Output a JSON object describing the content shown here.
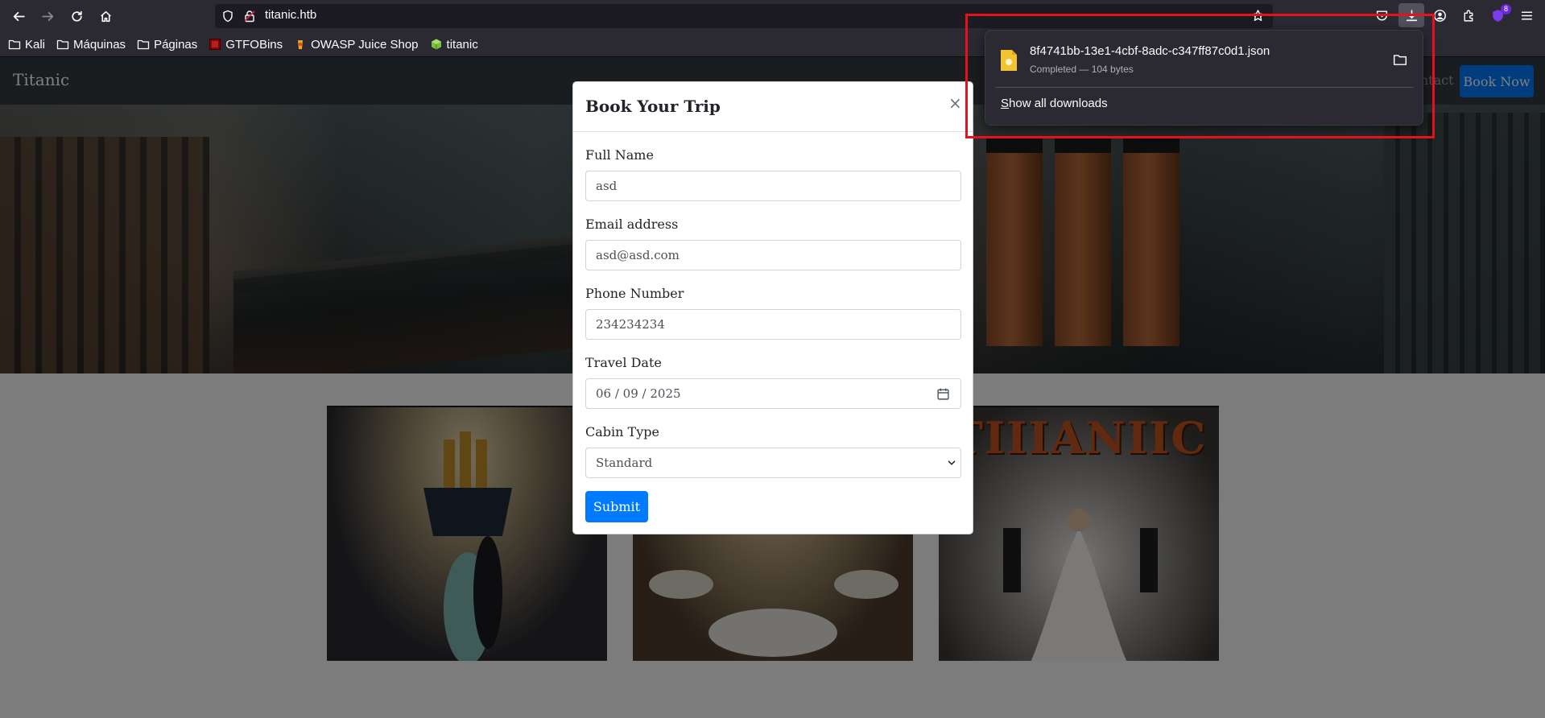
{
  "browser": {
    "url": "titanic.htb",
    "bookmarks": [
      {
        "label": "Kali",
        "icon": "folder-icon"
      },
      {
        "label": "Máquinas",
        "icon": "folder-icon"
      },
      {
        "label": "Páginas",
        "icon": "folder-icon"
      },
      {
        "label": "GTFOBins",
        "icon": "gtfobins-icon"
      },
      {
        "label": "OWASP Juice Shop",
        "icon": "juice-shop-icon"
      },
      {
        "label": "titanic",
        "icon": "cube-icon"
      }
    ],
    "extension_badge": "8"
  },
  "site": {
    "brand": "Titanic",
    "nav_contact": "Contact",
    "book_now": "Book Now"
  },
  "modal": {
    "title": "Book Your Trip",
    "close": "×",
    "fields": {
      "name": {
        "label": "Full Name",
        "value": "asd"
      },
      "email": {
        "label": "Email address",
        "value": "asd@asd.com"
      },
      "phone": {
        "label": "Phone Number",
        "value": "234234234"
      },
      "date": {
        "label": "Travel Date",
        "value": "06 / 09 / 2025"
      },
      "cabin": {
        "label": "Cabin Type",
        "value": "Standard"
      }
    },
    "submit": "Submit"
  },
  "downloads": {
    "file_name": "8f4741bb-13e1-4cbf-8adc-c347ff87c0d1.json",
    "status": "Completed — 104 bytes",
    "show_all": "Show all downloads"
  },
  "cards": {
    "poster_title": "TIIIANIIC"
  },
  "colors": {
    "primary": "#007bff",
    "navbar": "#343a40",
    "highlight": "#e8101a",
    "chrome": "#2b2a33"
  }
}
